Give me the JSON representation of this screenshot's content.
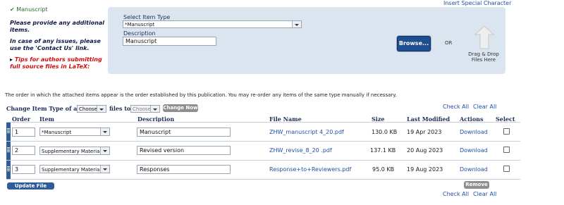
{
  "top_right_link": "Insert Special Character",
  "left_info": {
    "status_text": "Manuscript",
    "instructions": [
      "Please provide any additional",
      "items."
    ],
    "issues": [
      "In case of any issues, please",
      "use the 'Contact Us' link."
    ],
    "tips": [
      "Tips for authors submitting",
      "full source files in LaTeX:"
    ]
  },
  "upload": {
    "item_type_label": "Select Item Type",
    "item_type_value": "*Manuscript",
    "description_label": "Description",
    "description_value": "Manuscript",
    "browse_label": "Browse...",
    "or_text": "OR",
    "drag_drop": [
      "Drag & Drop",
      "Files Here"
    ]
  },
  "order_note": "The order in which the attached items appear is the order established by this publication. You may re-order any items of the same type manually if necessary.",
  "change_type": {
    "prefix": "Change Item Type of all",
    "from_value": "Choose",
    "files_to": "files to",
    "to_value": "Choose",
    "button": "Change Now"
  },
  "check_all": "Check All",
  "clear_all": "Clear All",
  "table": {
    "headers": [
      "Order",
      "Item",
      "Description",
      "File Name",
      "Size",
      "Last Modified",
      "Actions",
      "Select"
    ],
    "rows": [
      {
        "order": "1",
        "item": "*Manuscript",
        "description": "Manuscript",
        "file": "ZHW_manuscript 4_20.pdf",
        "size": "130.0 KB",
        "modified": "19 Apr 2023",
        "action": "Download"
      },
      {
        "order": "2",
        "item": "Supplementary Material",
        "description": "Revised version",
        "file": "ZHW_revise_8_20 .pdf",
        "size": "137.1 KB",
        "modified": "20 Aug 2023",
        "action": "Download"
      },
      {
        "order": "3",
        "item": "Supplementary Material",
        "description": "Responses",
        "file": "Response+to+Reviewers.pdf",
        "size": "95.0 KB",
        "modified": "19 Aug 2023",
        "action": "Download"
      }
    ]
  },
  "update_button": "Update File Order",
  "remove_button": "Remove",
  "colors": {
    "accent": "#2f5d9b",
    "panel": "#dbe5ef",
    "link": "#1f4fa8",
    "tip_red": "#d10d0d",
    "check_green": "#2e8b2e"
  }
}
